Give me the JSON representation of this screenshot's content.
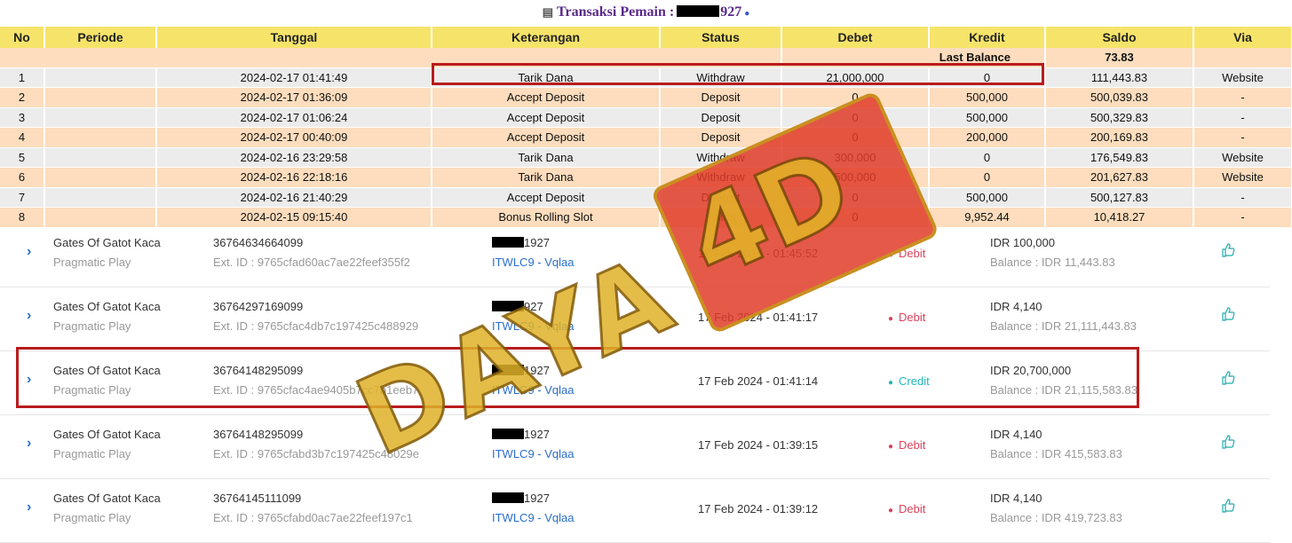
{
  "title": {
    "prefix": "Transaksi  Pemain :",
    "suffix": "927"
  },
  "table": {
    "headers": [
      "No",
      "Periode",
      "Tanggal",
      "Keterangan",
      "Status",
      "Debet",
      "Kredit",
      "Saldo",
      "Via"
    ],
    "last_balance": {
      "label": "Last Balance",
      "value": "73.83"
    },
    "rows": [
      {
        "no": "1",
        "periode": "",
        "tanggal": "2024-02-17 01:41:49",
        "keterangan": "Tarik Dana",
        "status": "Withdraw",
        "debet": "21,000,000",
        "kredit": "0",
        "saldo": "111,443.83",
        "via": "Website"
      },
      {
        "no": "2",
        "periode": "",
        "tanggal": "2024-02-17 01:36:09",
        "keterangan": "Accept Deposit",
        "status": "Deposit",
        "debet": "0",
        "kredit": "500,000",
        "saldo": "500,039.83",
        "via": "-"
      },
      {
        "no": "3",
        "periode": "",
        "tanggal": "2024-02-17 01:06:24",
        "keterangan": "Accept Deposit",
        "status": "Deposit",
        "debet": "0",
        "kredit": "500,000",
        "saldo": "500,329.83",
        "via": "-"
      },
      {
        "no": "4",
        "periode": "",
        "tanggal": "2024-02-17 00:40:09",
        "keterangan": "Accept Deposit",
        "status": "Deposit",
        "debet": "0",
        "kredit": "200,000",
        "saldo": "200,169.83",
        "via": "-"
      },
      {
        "no": "5",
        "periode": "",
        "tanggal": "2024-02-16 23:29:58",
        "keterangan": "Tarik Dana",
        "status": "Withdraw",
        "debet": "300,000",
        "kredit": "0",
        "saldo": "176,549.83",
        "via": "Website"
      },
      {
        "no": "6",
        "periode": "",
        "tanggal": "2024-02-16 22:18:16",
        "keterangan": "Tarik Dana",
        "status": "Withdraw",
        "debet": "500,000",
        "kredit": "0",
        "saldo": "201,627.83",
        "via": "Website"
      },
      {
        "no": "7",
        "periode": "",
        "tanggal": "2024-02-16 21:40:29",
        "keterangan": "Accept Deposit",
        "status": "Deposit",
        "debet": "0",
        "kredit": "500,000",
        "saldo": "500,127.83",
        "via": "-"
      },
      {
        "no": "8",
        "periode": "",
        "tanggal": "2024-02-15 09:15:40",
        "keterangan": "Bonus Rolling Slot",
        "status": "rolling",
        "debet": "0",
        "kredit": "9,952.44",
        "saldo": "10,418.27",
        "via": "-"
      }
    ]
  },
  "bets": [
    {
      "game": "Gates Of Gatot Kaca",
      "provider": "Pragmatic Play",
      "bet_id": "36764634664099",
      "ext_id": "Ext. ID : 9765cfad60ac7ae22feef355f2",
      "user": "1927",
      "agent": "ITWLC9 - Vqlaa",
      "time": "17 Feb 2024 - 01:45:52",
      "type": "Debit",
      "amount": "IDR 100,000",
      "balance": "Balance : IDR 11,443.83"
    },
    {
      "game": "Gates Of Gatot Kaca",
      "provider": "Pragmatic Play",
      "bet_id": "36764297169099",
      "ext_id": "Ext. ID : 9765cfac4db7c197425c488929",
      "user": "927",
      "agent": "ITWLC9 - Vqlaa",
      "time": "17 Feb 2024 - 01:41:17",
      "type": "Debit",
      "amount": "IDR 4,140",
      "balance": "Balance : IDR 21,111,443.83"
    },
    {
      "game": "Gates Of Gatot Kaca",
      "provider": "Pragmatic Play",
      "bet_id": "36764148295099",
      "ext_id": "Ext. ID : 9765cfac4ae9405b7cc7b1eeb7",
      "user": "1927",
      "agent": "ITWLC9 - Vqlaa",
      "time": "17 Feb 2024 - 01:41:14",
      "type": "Credit",
      "amount": "IDR 20,700,000",
      "balance": "Balance : IDR 21,115,583.83"
    },
    {
      "game": "Gates Of Gatot Kaca",
      "provider": "Pragmatic Play",
      "bet_id": "36764148295099",
      "ext_id": "Ext. ID : 9765cfabd3b7c197425c48029e",
      "user": "1927",
      "agent": "ITWLC9 - Vqlaa",
      "time": "17 Feb 2024 - 01:39:15",
      "type": "Debit",
      "amount": "IDR 4,140",
      "balance": "Balance : IDR 415,583.83"
    },
    {
      "game": "Gates Of Gatot Kaca",
      "provider": "Pragmatic Play",
      "bet_id": "36764145111099",
      "ext_id": "Ext. ID : 9765cfabd0ac7ae22feef197c1",
      "user": "1927",
      "agent": "ITWLC9 - Vqlaa",
      "time": "17 Feb 2024 - 01:39:12",
      "type": "Debit",
      "amount": "IDR 4,140",
      "balance": "Balance : IDR 419,723.83"
    }
  ],
  "colors": {
    "debit": "#d9435c",
    "credit": "#1fb8b8"
  },
  "watermark": {
    "text": "DAYA",
    "badge": "4D"
  }
}
